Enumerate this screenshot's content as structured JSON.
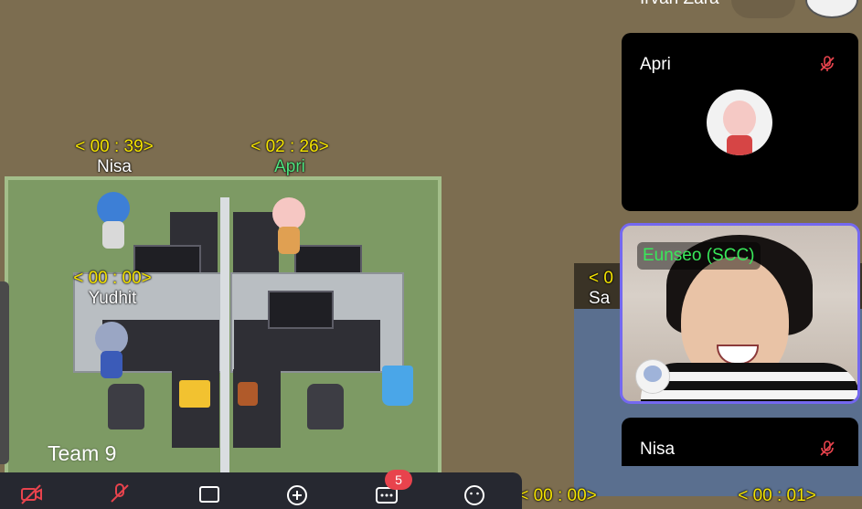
{
  "map": {
    "team_label": "Team 9",
    "players": [
      {
        "timer": "< 00 : 39>",
        "name": "Nisa"
      },
      {
        "timer": "< 02 : 26>",
        "name": "Apri"
      },
      {
        "timer": "< 00 : 00>",
        "name": "Yudhit"
      }
    ],
    "partial_tags": [
      {
        "timer": "< 0",
        "name": "Sa"
      },
      {
        "timer": "< 00 : 00>"
      },
      {
        "timer": "< 00 : 01>"
      }
    ],
    "top_partial_name": "Irvan Zara"
  },
  "video_panel": {
    "tiles": [
      {
        "name": "Apri",
        "muted": true
      },
      {
        "name": "Eunseo (SCC)",
        "camera_on": true
      },
      {
        "name": "Nisa",
        "muted": true
      }
    ]
  },
  "toolbar": {
    "buttons": [
      {
        "icon": "camera-off-icon",
        "color": "#e8434d"
      },
      {
        "icon": "mic-off-icon",
        "color": "#e8434d"
      },
      {
        "icon": "screen-share-icon",
        "color": "#ffffff"
      },
      {
        "icon": "plus-circle-icon",
        "color": "#ffffff"
      },
      {
        "icon": "chat-icon",
        "color": "#ffffff"
      },
      {
        "icon": "emoji-icon",
        "color": "#ffffff"
      }
    ],
    "chat_badge": "5"
  },
  "colors": {
    "timer": "#f5e400",
    "highlight_name": "#4ee37f",
    "cam_label": "#39e85a",
    "active_border": "#7468f0",
    "muted": "#e8434d"
  }
}
